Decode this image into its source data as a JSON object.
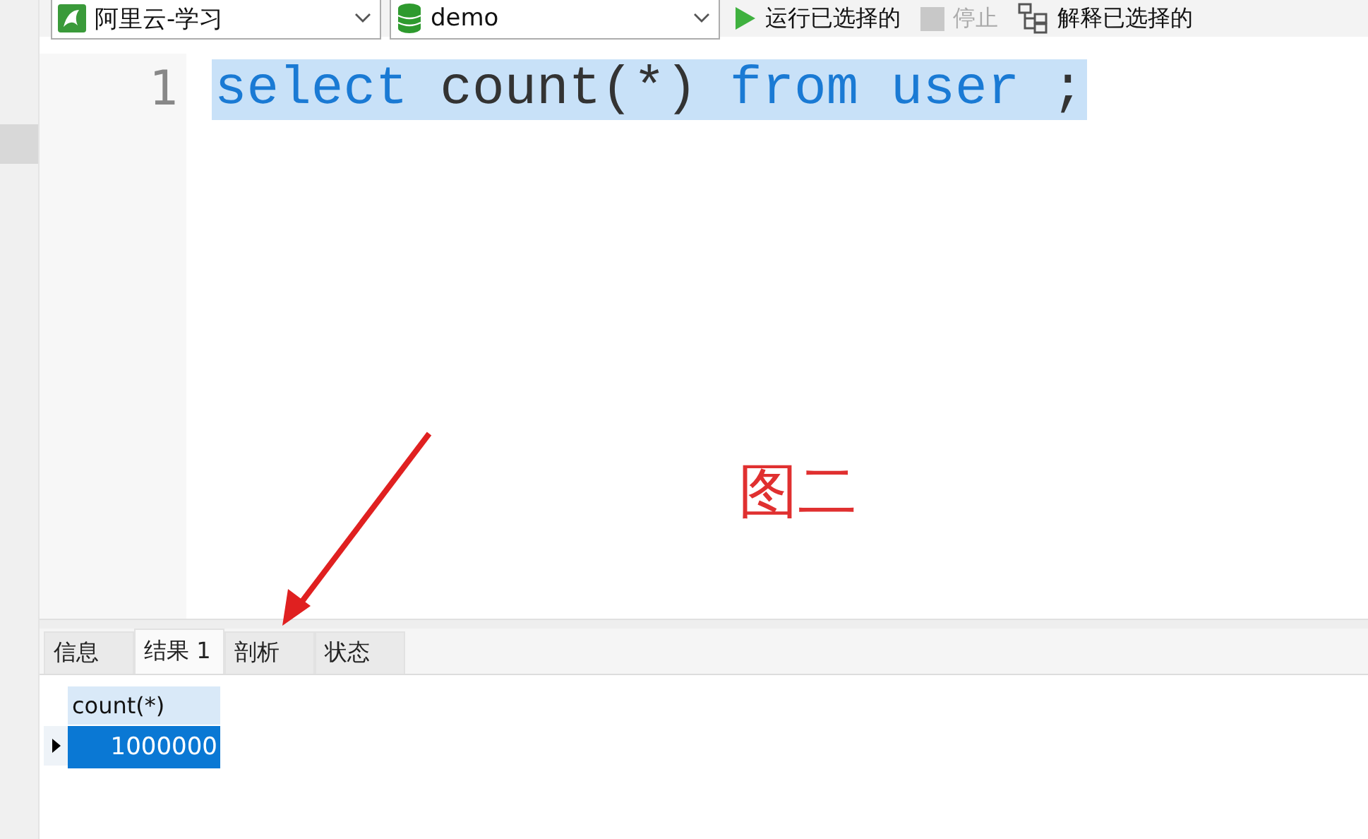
{
  "toolbar": {
    "connection": {
      "value": "阿里云-学习"
    },
    "database": {
      "value": "demo"
    },
    "buttons": [
      {
        "kind": "run",
        "label": "运行已选择的",
        "disabled": false
      },
      {
        "kind": "stop",
        "label": "停止",
        "disabled": true
      },
      {
        "kind": "explain",
        "label": "解释已选择的",
        "disabled": false
      }
    ]
  },
  "editor": {
    "lines": [
      {
        "number": "1",
        "selected": true,
        "tokens": [
          {
            "kind": "keyword",
            "text": "select"
          },
          {
            "kind": "plain",
            "text": "count(*)"
          },
          {
            "kind": "keyword",
            "text": "from"
          },
          {
            "kind": "keyword",
            "text": "user"
          },
          {
            "kind": "plain",
            "text": ";"
          }
        ]
      }
    ]
  },
  "annotation": {
    "label": "图二"
  },
  "result_tabs": [
    {
      "label": "信息",
      "selected": false
    },
    {
      "label": "结果 1",
      "selected": true
    },
    {
      "label": "剖析",
      "selected": false
    },
    {
      "label": "状态",
      "selected": false
    }
  ],
  "table": {
    "columns": [
      "count(*)"
    ],
    "rows": [
      {
        "selected": true,
        "cells": [
          "1000000"
        ]
      }
    ]
  }
}
